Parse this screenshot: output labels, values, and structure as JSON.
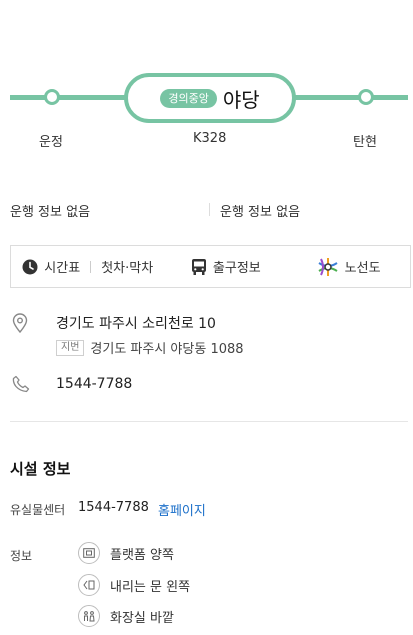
{
  "station": {
    "line_badge": "경의중앙",
    "name": "야당",
    "code": "K328",
    "prev_name": "운정",
    "next_name": "탄현",
    "line_color": "#77c4a3"
  },
  "operation": {
    "left": "운행 정보 없음",
    "right": "운행 정보 없음"
  },
  "actions": {
    "timetable": "시간표",
    "first_last": "첫차·막차",
    "exit_info": "출구정보",
    "route_map": "노선도"
  },
  "address": {
    "road": "경기도 파주시 소리천로 10",
    "jibun_badge": "지번",
    "jibun": "경기도 파주시 야당동 1088",
    "icon": "map-pin-icon"
  },
  "phone": {
    "number": "1544-7788",
    "icon": "phone-icon"
  },
  "facility": {
    "title": "시설 정보",
    "lost_label": "유실물센터",
    "lost_phone": "1544-7788",
    "homepage": "홈페이지",
    "info_label": "정보",
    "items": [
      {
        "label": "플랫폼 양쪽",
        "icon": "platform-icon"
      },
      {
        "label": "내리는 문 왼쪽",
        "icon": "door-left-icon"
      },
      {
        "label": "화장실 바깥",
        "icon": "restroom-icon"
      }
    ]
  }
}
